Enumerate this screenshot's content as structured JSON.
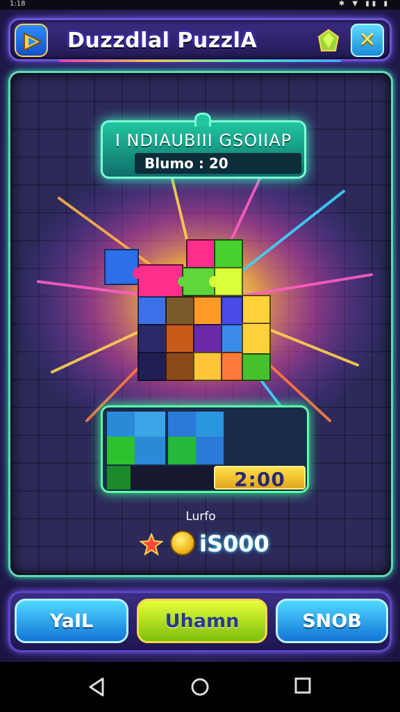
{
  "status": {
    "time": "1:18",
    "battery": "85%"
  },
  "header": {
    "title": "Duzzdlal PuzzlA",
    "logo_icon": "play-icon",
    "gem_icon": "gem-icon",
    "close_icon": "close-icon"
  },
  "banner": {
    "title": "I NDIAUBIII GSOIIAP",
    "subtitle": "Blumo : 20"
  },
  "tray": {
    "timer": "2:00"
  },
  "score": {
    "label": "Lurfo",
    "value": "iS000",
    "star_icon": "star-icon",
    "coin_icon": "coin-icon"
  },
  "buttons": {
    "left": "YaIL",
    "center": "Uhamn",
    "right": "SNOB"
  },
  "colors": {
    "accent_green": "#5fd9b5",
    "gold": "#ffd34d",
    "purple_bg": "#2c2463"
  }
}
